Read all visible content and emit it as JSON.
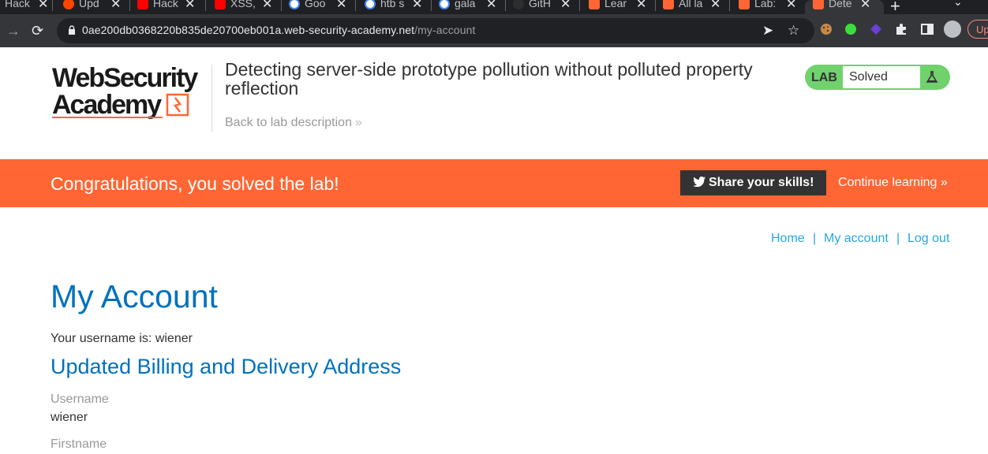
{
  "browser": {
    "tabs": [
      {
        "title": "Hack",
        "color": "#1f2023"
      },
      {
        "title": "Upd",
        "color": "#ff4500"
      },
      {
        "title": "Hack",
        "color": "#ff0000"
      },
      {
        "title": "XSS,",
        "color": "#ff0000"
      },
      {
        "title": "Goo",
        "color": "#4285f4"
      },
      {
        "title": "htb s",
        "color": "#4285f4"
      },
      {
        "title": "gala",
        "color": "#4285f4"
      },
      {
        "title": "GitH",
        "color": "#e8eaed"
      },
      {
        "title": "Lear",
        "color": "#ff6633"
      },
      {
        "title": "All la",
        "color": "#ff6633"
      },
      {
        "title": "Lab:",
        "color": "#ff6633"
      },
      {
        "title": "Dete",
        "color": "#ff6633"
      }
    ],
    "url_domain": "0ae200db0368220b835de20700eb001a.web-security-academy.net",
    "url_path": "/my-account",
    "update_label": "Up"
  },
  "header": {
    "logo_line1": "WebSecurity",
    "logo_line2": "Academy",
    "lab_title": "Detecting server-side prototype pollution without polluted property reflection",
    "back_link": "Back to lab description",
    "lab_badge": "LAB",
    "lab_status": "Solved",
    "status_color": "#70d16d"
  },
  "banner": {
    "message": "Congratulations, you solved the lab!",
    "share_label": "Share your skills!",
    "continue_label": "Continue learning",
    "color": "#ff6633"
  },
  "nav": {
    "home": "Home",
    "my_account": "My account",
    "log_out": "Log out",
    "separator": "|"
  },
  "account": {
    "title": "My Account",
    "username_line": "Your username is: wiener",
    "subtitle": "Updated Billing and Delivery Address",
    "fields": [
      {
        "label": "Username",
        "value": "wiener"
      },
      {
        "label": "Firstname",
        "value": ""
      }
    ]
  }
}
